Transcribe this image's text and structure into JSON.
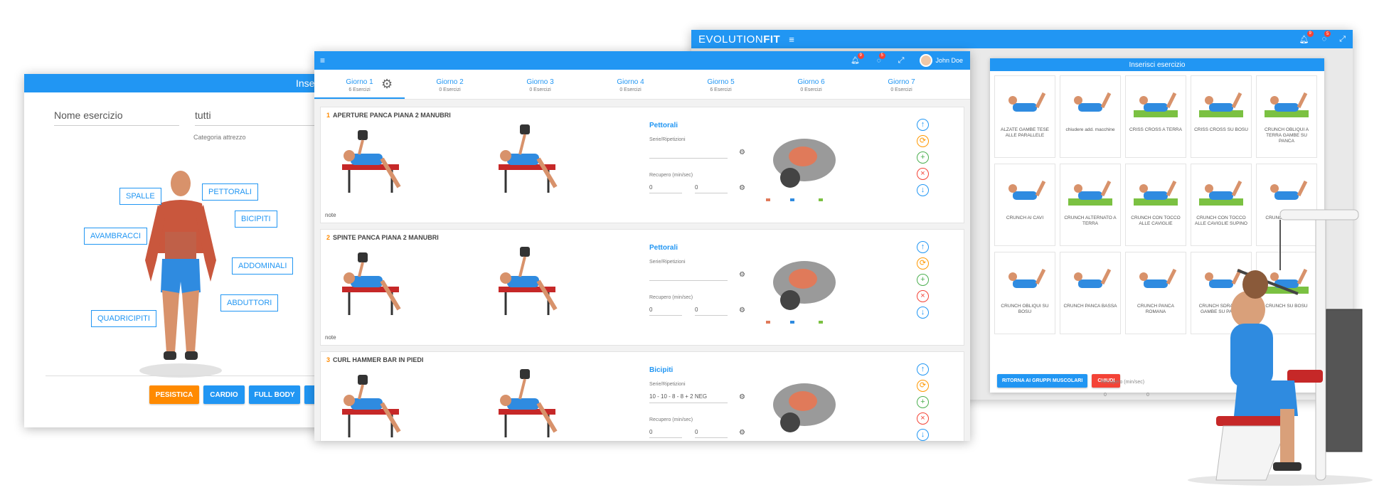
{
  "back_window": {
    "brand_light": "EVOLUTION",
    "brand_bold": "FIT",
    "badge_bell": "9",
    "badge_chat": "5",
    "dialog_title": "Inserisci esercizio",
    "exercises": [
      "ALZATE GAMBE TESE ALLE PARALLELE",
      "chiudere add. macchine",
      "CRISS CROSS A TERRA",
      "CRISS CROSS SU BOSU",
      "CRUNCH OBLIQUI A TERRA GAMBE SU PANCA",
      "CRUNCH AI CAVI",
      "CRUNCH ALTERNATO A TERRA",
      "CRUNCH CON TOCCO ALLE CAVIGLIE",
      "CRUNCH CON TOCCO ALLE CAVIGLIE SUPINO",
      "CRUNCH INVERSO",
      "CRUNCH OBLIQUI SU BOSU",
      "CRUNCH PANCA BASSA",
      "CRUNCH PANCA ROMANA",
      "CRUNCH SDRAIATO GAMBE SU PANCA",
      "CRUNCH SU BOSU"
    ],
    "btn_back": "RITORNA AI GRUPPI MUSCOLARI",
    "btn_close": "CHIUDI",
    "footer_label": "Recupero (min/sec)",
    "footer_val1": "0",
    "footer_val2": "0"
  },
  "left_window": {
    "title": "Inse",
    "name_placeholder": "Nome esercizio",
    "equipment_value": "tutti",
    "equipment_label": "Categoria attrezzo",
    "muscles": {
      "spalle": "SPALLE",
      "pettorali": "PETTORALI",
      "bicipiti": "BICIPITI",
      "avambracci": "AVAMBRACCI",
      "addominali": "ADDOMINALI",
      "abduttori": "ABDUTTORI",
      "quadricipiti": "QUADRICIPITI"
    },
    "btn_pesistica": "PESISTICA",
    "btn_cardio": "CARDIO",
    "btn_fullbody": "FULL BODY"
  },
  "main_window": {
    "badge_bell": "9",
    "badge_chat": "5",
    "user_name": "John Doe",
    "days": [
      {
        "name": "Giorno 1",
        "count": "6 Esercizi"
      },
      {
        "name": "Giorno 2",
        "count": "0 Esercizi"
      },
      {
        "name": "Giorno 3",
        "count": "0 Esercizi"
      },
      {
        "name": "Giorno 4",
        "count": "0 Esercizi"
      },
      {
        "name": "Giorno 5",
        "count": "6 Esercizi"
      },
      {
        "name": "Giorno 6",
        "count": "0 Esercizi"
      },
      {
        "name": "Giorno 7",
        "count": "0 Esercizi"
      }
    ],
    "rows": [
      {
        "num": "1",
        "title": "APERTURE PANCA PIANA 2 MANUBRI",
        "muscle": "Pettorali",
        "series_label": "Serie/Ripetizioni",
        "series_value": "",
        "rec_label": "Recupero (min/sec)",
        "rec_min": "0",
        "rec_sec": "0",
        "note": "note"
      },
      {
        "num": "2",
        "title": "SPINTE PANCA PIANA 2 MANUBRI",
        "muscle": "Pettorali",
        "series_label": "Serie/Ripetizioni",
        "series_value": "",
        "rec_label": "Recupero (min/sec)",
        "rec_min": "0",
        "rec_sec": "0",
        "note": "note"
      },
      {
        "num": "3",
        "title": "CURL HAMMER BAR IN PIEDI",
        "muscle": "Bicipiti",
        "series_label": "Serie/Ripetizioni",
        "series_value": "10 - 10 - 8 - 8 + 2 NEG",
        "rec_label": "Recupero (min/sec)",
        "rec_min": "0",
        "rec_sec": "0",
        "note": ""
      }
    ]
  },
  "colors": {
    "primary": "#2196f3",
    "orange": "#ff8a00",
    "red": "#f44336",
    "green": "#4caf50",
    "athlete_blue": "#2f8be0"
  }
}
